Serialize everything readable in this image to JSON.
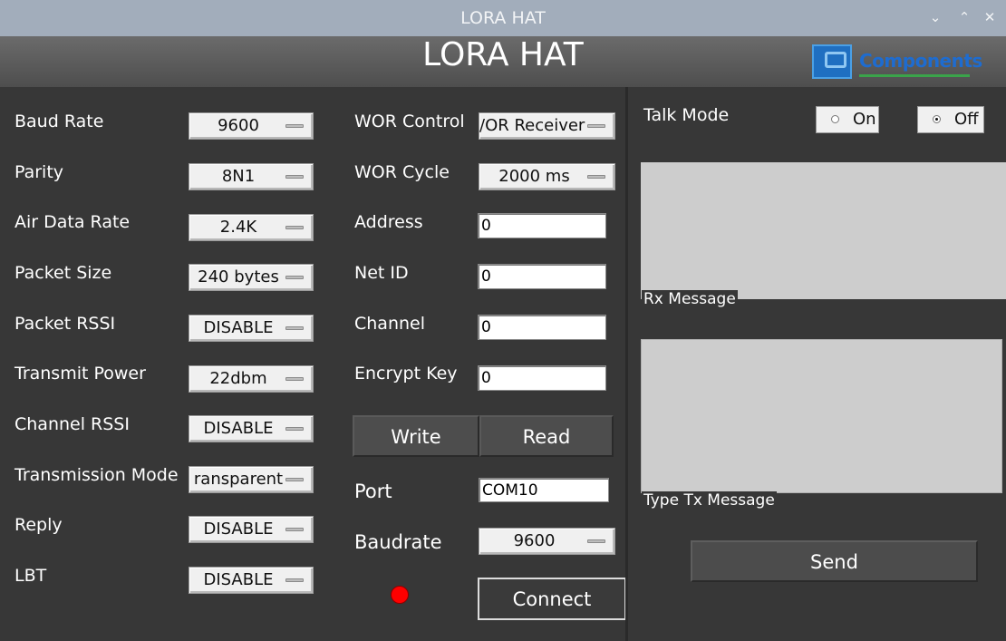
{
  "window": {
    "title": "LORA HAT"
  },
  "header": {
    "title": "LORA HAT",
    "logo_text": "Components"
  },
  "left_settings": [
    {
      "label": "Baud Rate",
      "value": "9600"
    },
    {
      "label": "Parity",
      "value": "8N1"
    },
    {
      "label": "Air Data Rate",
      "value": "2.4K"
    },
    {
      "label": "Packet Size",
      "value": "240 bytes"
    },
    {
      "label": "Packet RSSI",
      "value": "DISABLE"
    },
    {
      "label": "Transmit Power",
      "value": "22dbm"
    },
    {
      "label": "Channel RSSI",
      "value": "DISABLE"
    },
    {
      "label": "Transmission Mode",
      "value": "ransparent"
    },
    {
      "label": "Reply",
      "value": "DISABLE"
    },
    {
      "label": "LBT",
      "value": "DISABLE"
    }
  ],
  "middle_settings": {
    "wor_control": {
      "label": "WOR Control",
      "value": "/OR Receiver"
    },
    "wor_cycle": {
      "label": "WOR Cycle",
      "value": "2000 ms"
    },
    "address": {
      "label": "Address",
      "value": "0"
    },
    "net_id": {
      "label": "Net ID",
      "value": "0"
    },
    "channel": {
      "label": "Channel",
      "value": "0"
    },
    "encrypt_key": {
      "label": "Encrypt Key",
      "value": "0"
    }
  },
  "actions": {
    "write": "Write",
    "read": "Read"
  },
  "connection": {
    "port_label": "Port",
    "port_value": "COM10",
    "baudrate_label": "Baudrate",
    "baudrate_value": "9600",
    "connect": "Connect",
    "status_color": "#ff0000"
  },
  "talk": {
    "label": "Talk Mode",
    "on": "On",
    "off": "Off",
    "selected": "Off",
    "rx_label": "Rx Message",
    "tx_label": "Type Tx Message",
    "send": "Send"
  }
}
